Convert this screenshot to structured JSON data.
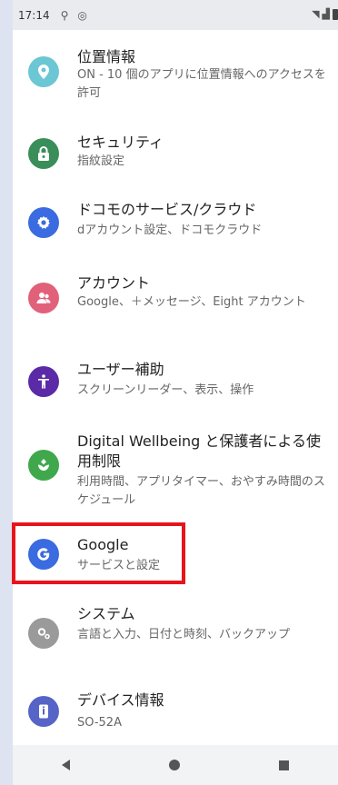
{
  "status": {
    "time": "17:14"
  },
  "items": [
    {
      "title": "位置情報",
      "subtitle": "ON - 10 個のアプリに位置情報へのアクセスを許可",
      "icon": "location-icon",
      "color": "#6cc7d4"
    },
    {
      "title": "セキュリティ",
      "subtitle": "指紋設定",
      "icon": "lock-icon",
      "color": "#3a8e5a"
    },
    {
      "title": "ドコモのサービス/クラウド",
      "subtitle": "dアカウント設定、ドコモクラウド",
      "icon": "gear-icon",
      "color": "#3a6be0"
    },
    {
      "title": "アカウント",
      "subtitle": "Google、＋メッセージ、Eight アカウント",
      "icon": "account-icon",
      "color": "#e2617a"
    },
    {
      "title": "ユーザー補助",
      "subtitle": "スクリーンリーダー、表示、操作",
      "icon": "accessibility-icon",
      "color": "#5b2aa7"
    },
    {
      "title": "Digital Wellbeing と保護者による使用制限",
      "subtitle": "利用時間、アプリタイマー、おやすみ時間のスケジュール",
      "icon": "wellbeing-icon",
      "color": "#3fa84c"
    },
    {
      "title": "Google",
      "subtitle": "サービスと設定",
      "icon": "google-icon",
      "color": "#3a6be0"
    },
    {
      "title": "システム",
      "subtitle": "言語と入力、日付と時刻、バックアップ",
      "icon": "system-icon",
      "color": "#9a9a9a"
    },
    {
      "title": "デバイス情報",
      "subtitle": "SO-52A",
      "icon": "device-info-icon",
      "color": "#5664c7"
    }
  ]
}
